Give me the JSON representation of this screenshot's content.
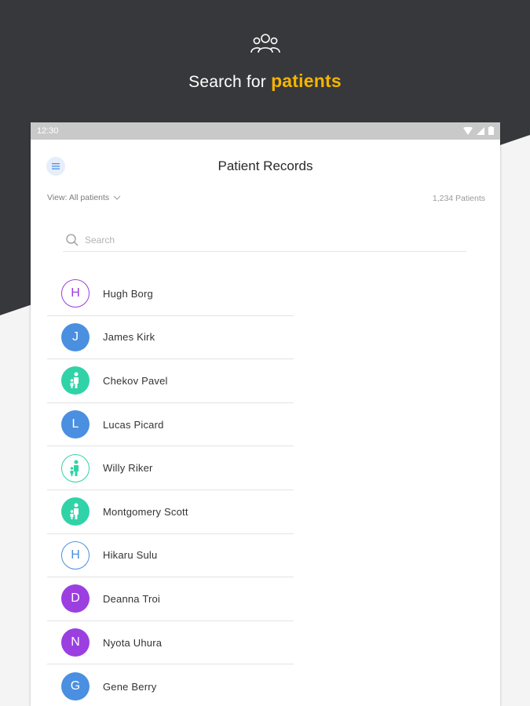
{
  "colors": {
    "dark_background": "#36383b",
    "light_background": "#f4f4f5",
    "accent_yellow": "#f5b400",
    "blue": "#4a8fe0",
    "purple": "#9b3fe0",
    "teal": "#2fd3a7"
  },
  "hero": {
    "icon": "group-people-icon",
    "title_prefix": "Search for",
    "title_accent": "patients"
  },
  "device": {
    "status_time": "12:30",
    "status_icons": [
      "wifi-icon",
      "signal-icon",
      "battery-icon"
    ]
  },
  "appbar": {
    "menu_icon": "menu-icon",
    "title": "Patient Records"
  },
  "view": {
    "label": "View: All patients",
    "dropdown_icon": "chevron-down-icon",
    "count": "1,234 Patients"
  },
  "search": {
    "placeholder": "Search",
    "value": ""
  },
  "patients": [
    {
      "name": "Hugh Borg",
      "initial": "H",
      "avatar_style": "outline",
      "color": "#9b3fe0",
      "icon": ""
    },
    {
      "name": "James Kirk",
      "initial": "J",
      "avatar_style": "filled",
      "color": "#4a8fe0",
      "icon": ""
    },
    {
      "name": "Chekov Pavel",
      "initial": "",
      "avatar_style": "filled",
      "color": "#2fd3a7",
      "icon": "parent-child-icon"
    },
    {
      "name": "Lucas Picard",
      "initial": "L",
      "avatar_style": "filled",
      "color": "#4a8fe0",
      "icon": ""
    },
    {
      "name": "Willy Riker",
      "initial": "",
      "avatar_style": "outline",
      "color": "#2fd3a7",
      "icon": "parent-child-icon"
    },
    {
      "name": "Montgomery Scott",
      "initial": "",
      "avatar_style": "filled",
      "color": "#2fd3a7",
      "icon": "parent-child-icon"
    },
    {
      "name": "Hikaru Sulu",
      "initial": "H",
      "avatar_style": "outline",
      "color": "#4a8fe0",
      "icon": ""
    },
    {
      "name": "Deanna Troi",
      "initial": "D",
      "avatar_style": "filled",
      "color": "#9b3fe0",
      "icon": ""
    },
    {
      "name": "Nyota Uhura",
      "initial": "N",
      "avatar_style": "filled",
      "color": "#9b3fe0",
      "icon": ""
    },
    {
      "name": "Gene Berry",
      "initial": "G",
      "avatar_style": "filled",
      "color": "#4a8fe0",
      "icon": ""
    }
  ]
}
